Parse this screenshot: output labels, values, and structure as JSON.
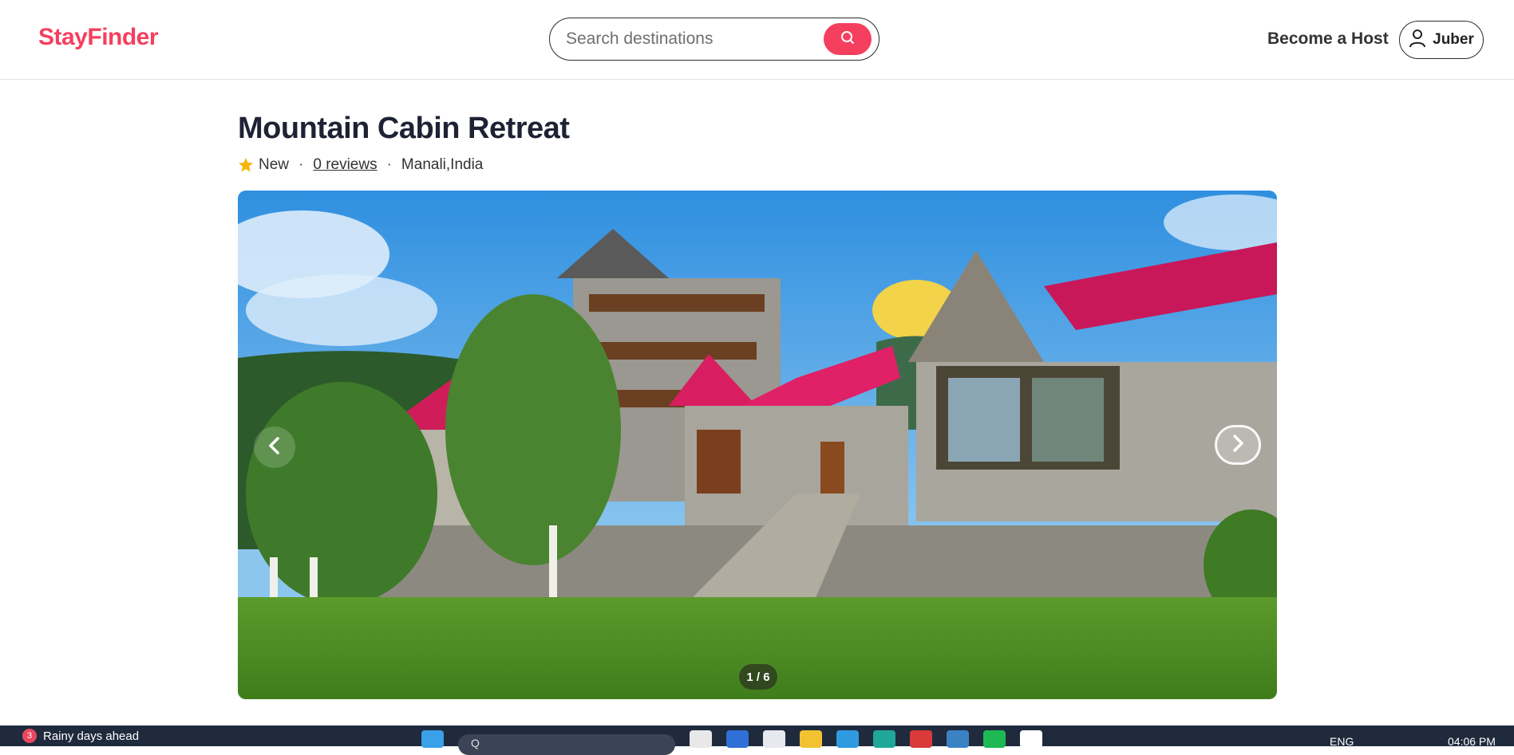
{
  "header": {
    "logo": "StayFinder",
    "search_placeholder": "Search destinations",
    "host_link": "Become a Host",
    "user_name": "Juber"
  },
  "listing": {
    "title": "Mountain Cabin Retreat",
    "rating_label": "New",
    "separator": "·",
    "reviews_link": "0 reviews",
    "location": "Manali,India"
  },
  "gallery": {
    "counter": "1 / 6",
    "current_index": 1,
    "total_images": 6
  },
  "taskbar": {
    "weather_badge": "3",
    "weather_text": "Rainy days ahead",
    "search_text": "Q",
    "lang": "ENG",
    "time": "04:06 PM"
  },
  "colors": {
    "brand": "#f43f5e",
    "star": "#f5b50a"
  },
  "icons": [
    "search-icon",
    "user-icon",
    "star-icon",
    "chevron-left-icon",
    "chevron-right-icon"
  ]
}
